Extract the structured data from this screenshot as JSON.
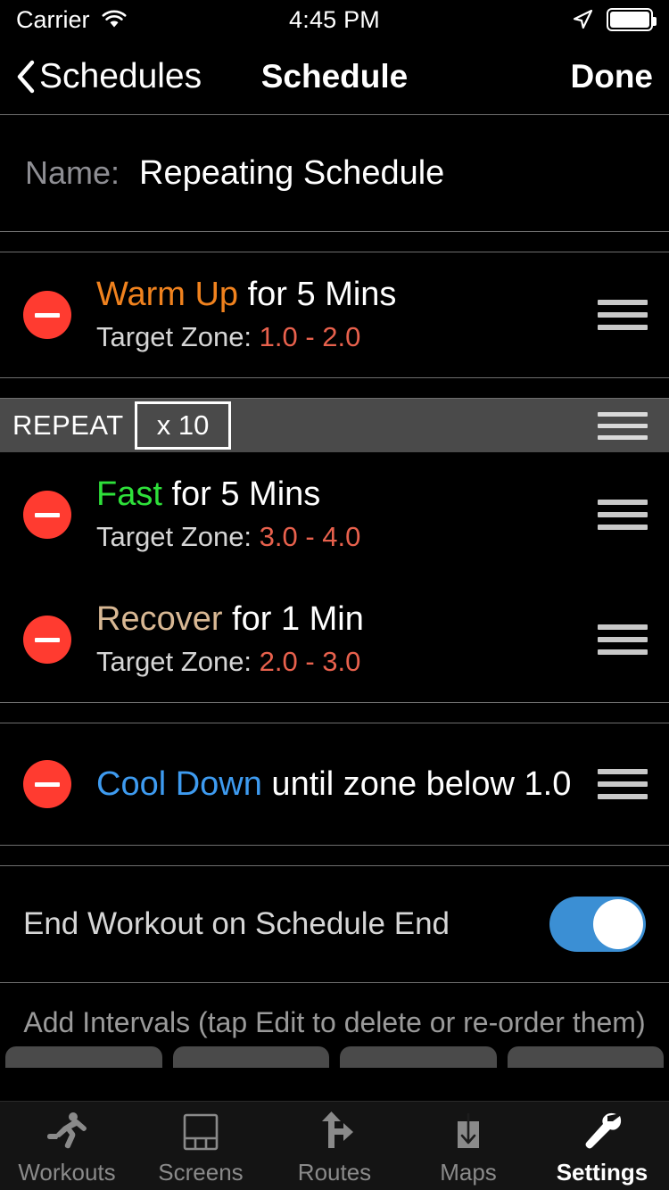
{
  "status_bar": {
    "carrier": "Carrier",
    "wifi_icon": "wifi-icon",
    "time": "4:45 PM",
    "location_icon": "location-arrow-icon",
    "battery_icon": "battery-full-icon"
  },
  "nav": {
    "back_icon": "chevron-left-icon",
    "back_label": "Schedules",
    "title": "Schedule",
    "done_label": "Done"
  },
  "name_section": {
    "label": "Name:",
    "value": "Repeating Schedule"
  },
  "intervals": {
    "warm_up": {
      "delete_icon": "minus-circle-icon",
      "kind": "Warm Up",
      "kind_color": "#f0821e",
      "detail": " for 5 Mins",
      "sub_label": "Target Zone: ",
      "sub_value": "1.0 - 2.0",
      "drag_icon": "drag-handle-icon"
    },
    "fast": {
      "delete_icon": "minus-circle-icon",
      "kind": "Fast",
      "kind_color": "#2ee03a",
      "detail": " for 5 Mins",
      "sub_label": "Target Zone: ",
      "sub_value": "3.0 - 4.0",
      "drag_icon": "drag-handle-icon"
    },
    "recover": {
      "delete_icon": "minus-circle-icon",
      "kind": "Recover",
      "kind_color": "#d8b894",
      "detail": " for 1 Min",
      "sub_label": "Target Zone: ",
      "sub_value": "2.0 - 3.0",
      "drag_icon": "drag-handle-icon"
    },
    "cool_down": {
      "delete_icon": "minus-circle-icon",
      "kind": "Cool Down",
      "kind_color": "#3e9bf0",
      "detail": " until zone below 1.0",
      "drag_icon": "drag-handle-icon"
    }
  },
  "repeat": {
    "label": "REPEAT",
    "count": "x 10",
    "drag_icon": "drag-handle-icon"
  },
  "toggle_section": {
    "label": "End Workout on Schedule End",
    "value": "on",
    "accent_color": "#3b8fd4"
  },
  "footer": {
    "hint": "Add Intervals (tap Edit to delete or re-order them)",
    "add_buttons": [
      "",
      "",
      "",
      ""
    ]
  },
  "tabbar": {
    "items": [
      {
        "label": "Workouts",
        "icon": "running-person-icon",
        "active": false
      },
      {
        "label": "Screens",
        "icon": "layout-grid-icon",
        "active": false
      },
      {
        "label": "Routes",
        "icon": "route-fork-arrow-icon",
        "active": false
      },
      {
        "label": "Maps",
        "icon": "download-box-icon",
        "active": false
      },
      {
        "label": "Settings",
        "icon": "wrench-icon",
        "active": true
      }
    ]
  },
  "colors": {
    "background": "#000000",
    "separator": "#6e6e6e",
    "delete_red": "#ff3b30",
    "repeat_bar": "#4a4a4a",
    "zone_red": "#e8614d"
  }
}
